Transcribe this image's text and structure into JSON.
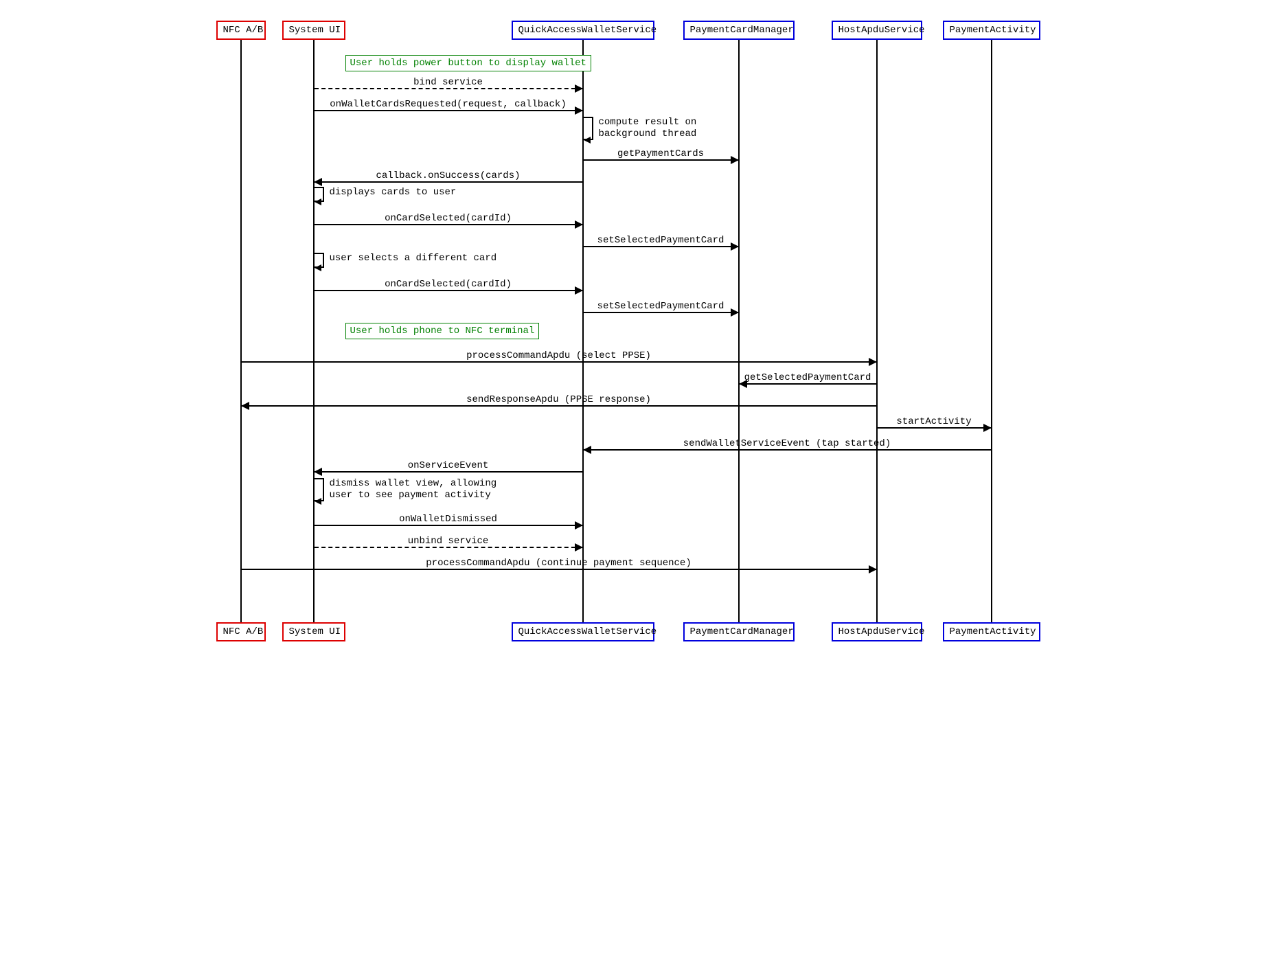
{
  "participants": {
    "nfc": "NFC A/B",
    "sysui": "System UI",
    "qaws": "QuickAccessWalletService",
    "pcm": "PaymentCardManager",
    "has": "HostApduService",
    "pa": "PaymentActivity"
  },
  "notes": {
    "n1": "User holds power button to display wallet",
    "n2": "User holds phone to NFC terminal"
  },
  "self": {
    "s1a": "compute result on",
    "s1b": "background thread",
    "s2": "displays cards to user",
    "s3": "user selects a different card",
    "s4a": "dismiss wallet view, allowing",
    "s4b": "user to see payment activity"
  },
  "messages": {
    "m1": "bind service",
    "m2": "onWalletCardsRequested(request, callback)",
    "m3": "getPaymentCards",
    "m4": "callback.onSuccess(cards)",
    "m5": "onCardSelected(cardId)",
    "m6": "setSelectedPaymentCard",
    "m7": "onCardSelected(cardId)",
    "m8": "setSelectedPaymentCard",
    "m9": "processCommandApdu (select PPSE)",
    "m10": "getSelectedPaymentCard",
    "m11": "sendResponseApdu (PPSE response)",
    "m12": "startActivity",
    "m13": "sendWalletServiceEvent (tap started)",
    "m14": "onServiceEvent",
    "m15": "onWalletDismissed",
    "m16": "unbind service",
    "m17": "processCommandApdu (continue payment sequence)"
  }
}
